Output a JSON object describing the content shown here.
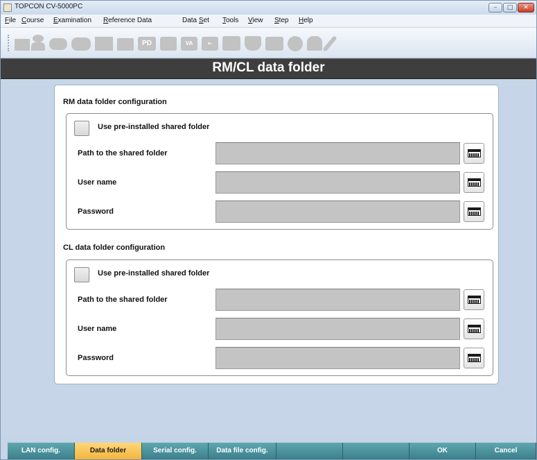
{
  "window": {
    "title": "TOPCON CV-5000PC",
    "controls": {
      "minimize": "–",
      "maximize": "□",
      "close": "✕"
    }
  },
  "menu": [
    {
      "label": "File",
      "accel": "F",
      "rest": "ile"
    },
    {
      "label": "Course",
      "accel": "C",
      "rest": "ourse"
    },
    {
      "label": "Examination",
      "accel": "E",
      "rest": "xamination"
    },
    {
      "label": "Reference Data",
      "accel": "R",
      "rest": "eference Data"
    },
    {
      "label": "Data Set",
      "pre": "Data ",
      "accel": "S",
      "rest": "et"
    },
    {
      "label": "Tools",
      "accel": "T",
      "rest": "ools"
    },
    {
      "label": "View",
      "accel": "V",
      "rest": "iew"
    },
    {
      "label": "Step",
      "accel": "S",
      "rest": "tep"
    },
    {
      "label": "Help",
      "accel": "H",
      "rest": "elp"
    }
  ],
  "toolbar": {
    "icons": [
      "chart-icon",
      "person-icon",
      "glasses-icon",
      "glasses-double-icon",
      "lens-meter-icon",
      "folder-icon",
      "pd-icon",
      "square-icon",
      "va-icon",
      "plus-minus-icon",
      "monitor-icon",
      "shield-icon",
      "book-icon",
      "circle-icon",
      "doctor-icon",
      "wrench-icon"
    ],
    "pd_label": "PD",
    "va_label": "VA",
    "pm_label": "+-"
  },
  "header": {
    "title": "RM/CL data folder"
  },
  "sections": [
    {
      "title": "RM data folder configuration",
      "checkbox_label": "Use pre-installed shared folder",
      "checked": false,
      "fields": [
        {
          "label": "Path to the shared folder",
          "value": ""
        },
        {
          "label": "User name",
          "value": ""
        },
        {
          "label": "Password",
          "value": ""
        }
      ]
    },
    {
      "title": "CL data folder configuration",
      "checkbox_label": "Use pre-installed shared folder",
      "checked": false,
      "fields": [
        {
          "label": "Path to the shared folder",
          "value": ""
        },
        {
          "label": "User name",
          "value": ""
        },
        {
          "label": "Password",
          "value": ""
        }
      ]
    }
  ],
  "tabs": [
    {
      "label": "LAN config.",
      "active": false
    },
    {
      "label": "Data folder",
      "active": true
    },
    {
      "label": "Serial config.",
      "active": false
    },
    {
      "label": "Data file config.",
      "active": false
    },
    {
      "label": "",
      "active": false
    },
    {
      "label": "",
      "active": false
    },
    {
      "label": "",
      "active": false
    },
    {
      "label": "OK",
      "active": false
    },
    {
      "label": "Cancel",
      "active": false
    }
  ],
  "colors": {
    "tab": "#4a929c",
    "tab_active": "#f6c050",
    "header": "#3e3e3e",
    "background": "#c6d5e8",
    "field": "#c4c4c4"
  }
}
